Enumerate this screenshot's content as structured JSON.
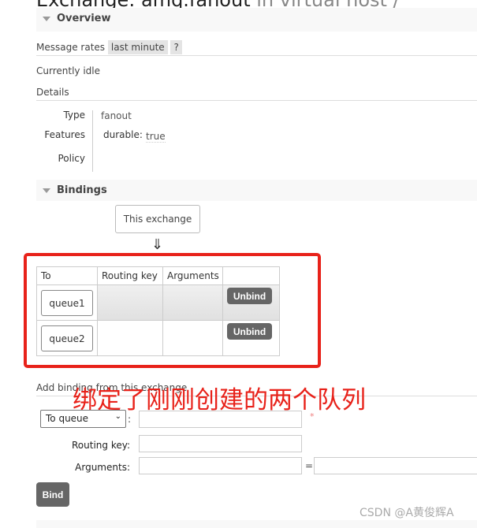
{
  "title": {
    "prefix": "Exchange: ",
    "name": "amq.fanout",
    "suffix": " in virtual host /"
  },
  "overview": {
    "heading": "Overview",
    "message_rates_label": "Message rates",
    "rate_period": "last minute",
    "help": "?",
    "status": "Currently idle",
    "details_heading": "Details",
    "type_label": "Type",
    "type_value": "fanout",
    "features_label": "Features",
    "feature_key": "durable:",
    "feature_value": "true",
    "policy_label": "Policy"
  },
  "bindings": {
    "heading": "Bindings",
    "this_exchange": "This exchange",
    "arrow": "⇓",
    "columns": [
      "To",
      "Routing key",
      "Arguments",
      ""
    ],
    "rows": [
      {
        "to": "queue1",
        "routing_key": "",
        "arguments": "",
        "action": "Unbind"
      },
      {
        "to": "queue2",
        "routing_key": "",
        "arguments": "",
        "action": "Unbind"
      }
    ]
  },
  "add_binding": {
    "heading": "Add binding from this exchange",
    "destination_type": "To queue",
    "required_mark": "*",
    "routing_key_label": "Routing key:",
    "arguments_label": "Arguments:",
    "equals": "=",
    "bind_label": "Bind",
    "colon": ":"
  },
  "annotation": "绑定了刚刚创建的两个队列",
  "watermark": "CSDN @A黄俊辉A",
  "colors": {
    "annotation": "#e8221a",
    "button": "#666666"
  }
}
